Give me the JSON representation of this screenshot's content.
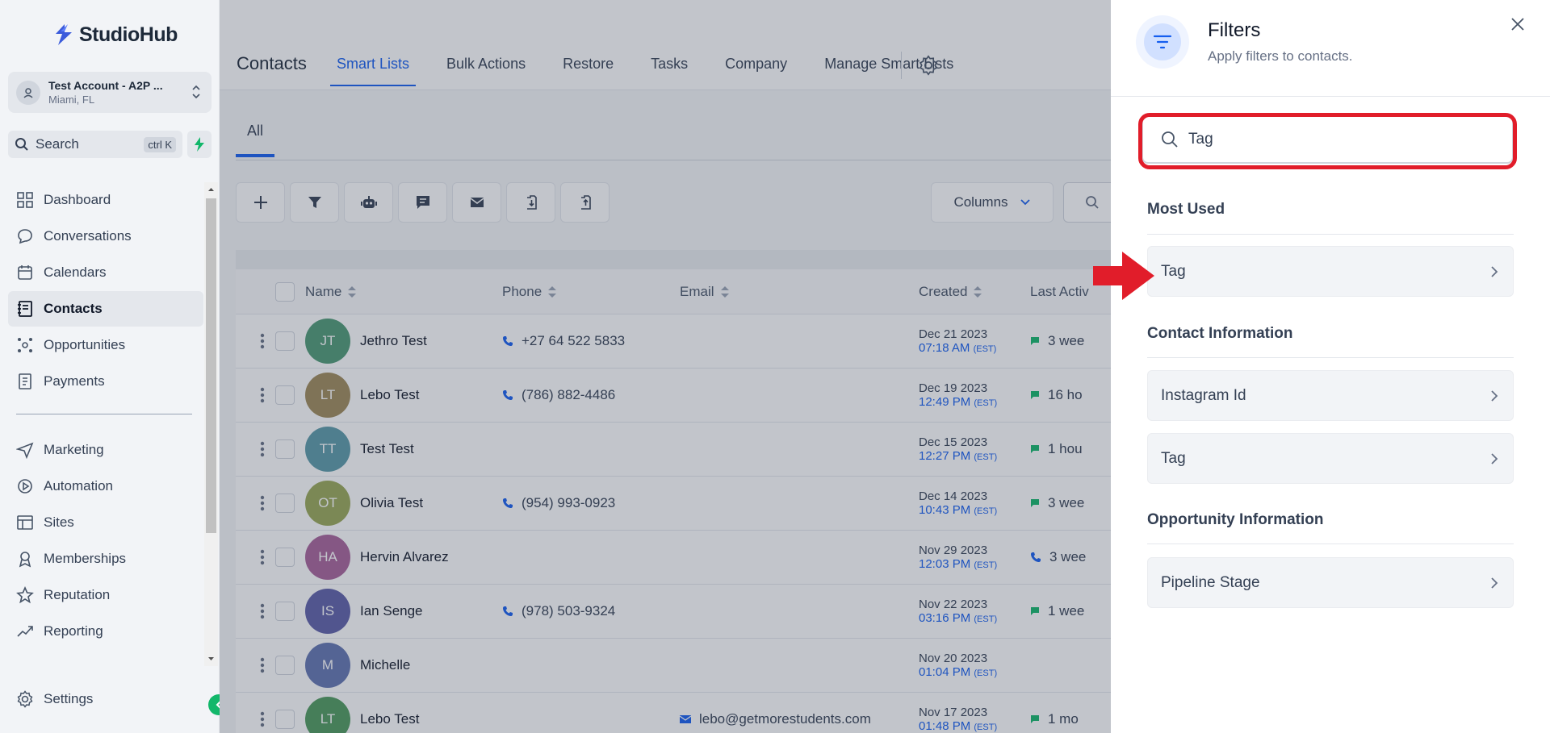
{
  "brand": {
    "name": "StudioHub"
  },
  "account": {
    "name": "Test Account - A2P ...",
    "location": "Miami, FL"
  },
  "sidebar_search": {
    "label": "Search",
    "shortcut": "ctrl K"
  },
  "nav": [
    {
      "label": "Dashboard",
      "icon": "dashboard-icon"
    },
    {
      "label": "Conversations",
      "icon": "chat-icon"
    },
    {
      "label": "Calendars",
      "icon": "calendar-icon"
    },
    {
      "label": "Contacts",
      "icon": "contacts-icon",
      "active": true
    },
    {
      "label": "Opportunities",
      "icon": "opportunities-icon"
    },
    {
      "label": "Payments",
      "icon": "payments-icon"
    }
  ],
  "nav2": [
    {
      "label": "Marketing",
      "icon": "send-icon"
    },
    {
      "label": "Automation",
      "icon": "automation-icon"
    },
    {
      "label": "Sites",
      "icon": "sites-icon"
    },
    {
      "label": "Memberships",
      "icon": "memberships-icon"
    },
    {
      "label": "Reputation",
      "icon": "star-icon"
    },
    {
      "label": "Reporting",
      "icon": "reporting-icon"
    }
  ],
  "settings_label": "Settings",
  "header": {
    "title": "Contacts",
    "tabs": [
      "Smart Lists",
      "Bulk Actions",
      "Restore",
      "Tasks",
      "Company",
      "Manage Smart Lists"
    ],
    "active_tab": "Smart Lists"
  },
  "subtab": "All",
  "columns_label": "Columns",
  "table": {
    "headers": {
      "name": "Name",
      "phone": "Phone",
      "email": "Email",
      "created": "Created",
      "activity": "Last Activ"
    },
    "rows": [
      {
        "initials": "JT",
        "color": "#4e9a74",
        "name": "Jethro Test",
        "phone": "+27 64 522 5833",
        "email": "",
        "date": "Dec 21 2023",
        "time": "07:18 AM",
        "tz": "(EST)",
        "activity": "3 wee",
        "activity_icon": "message"
      },
      {
        "initials": "LT",
        "color": "#a08a5a",
        "name": "Lebo Test",
        "phone": "(786) 882-4486",
        "email": "",
        "date": "Dec 19 2023",
        "time": "12:49 PM",
        "tz": "(EST)",
        "activity": "16 ho",
        "activity_icon": "message"
      },
      {
        "initials": "TT",
        "color": "#5b9aa8",
        "name": "Test Test",
        "phone": "",
        "email": "",
        "date": "Dec 15 2023",
        "time": "12:27 PM",
        "tz": "(EST)",
        "activity": "1 hou",
        "activity_icon": "message"
      },
      {
        "initials": "OT",
        "color": "#9aa856",
        "name": "Olivia Test",
        "phone": "(954) 993-0923",
        "email": "",
        "date": "Dec 14 2023",
        "time": "10:43 PM",
        "tz": "(EST)",
        "activity": "3 wee",
        "activity_icon": "message"
      },
      {
        "initials": "HA",
        "color": "#a8629a",
        "name": "Hervin Alvarez",
        "phone": "",
        "email": "",
        "date": "Nov 29 2023",
        "time": "12:03 PM",
        "tz": "(EST)",
        "activity": "3 wee",
        "activity_icon": "phone"
      },
      {
        "initials": "IS",
        "color": "#5e5fa8",
        "name": "Ian Senge",
        "phone": "(978) 503-9324",
        "email": "",
        "date": "Nov 22 2023",
        "time": "03:16 PM",
        "tz": "(EST)",
        "activity": "1 wee",
        "activity_icon": "message"
      },
      {
        "initials": "M",
        "color": "#6274b0",
        "name": "Michelle",
        "phone": "",
        "email": "",
        "date": "Nov 20 2023",
        "time": "01:04 PM",
        "tz": "(EST)",
        "activity": "",
        "activity_icon": ""
      },
      {
        "initials": "LT",
        "color": "#4e9a5c",
        "name": "Lebo Test",
        "phone": "",
        "email": "lebo@getmorestudents.com",
        "date": "Nov 17 2023",
        "time": "01:48 PM",
        "tz": "(EST)",
        "activity": "1 mo",
        "activity_icon": "message"
      }
    ]
  },
  "filters": {
    "title": "Filters",
    "subtitle": "Apply filters to contacts.",
    "search_value": "Tag",
    "sections": [
      {
        "title": "Most Used",
        "options": [
          "Tag"
        ]
      },
      {
        "title": "Contact Information",
        "options": [
          "Instagram Id",
          "Tag"
        ]
      },
      {
        "title": "Opportunity Information",
        "options": [
          "Pipeline Stage"
        ]
      }
    ]
  },
  "colors": {
    "accent": "#155eef",
    "highlight": "#e11d2a",
    "success": "#12b76a"
  }
}
